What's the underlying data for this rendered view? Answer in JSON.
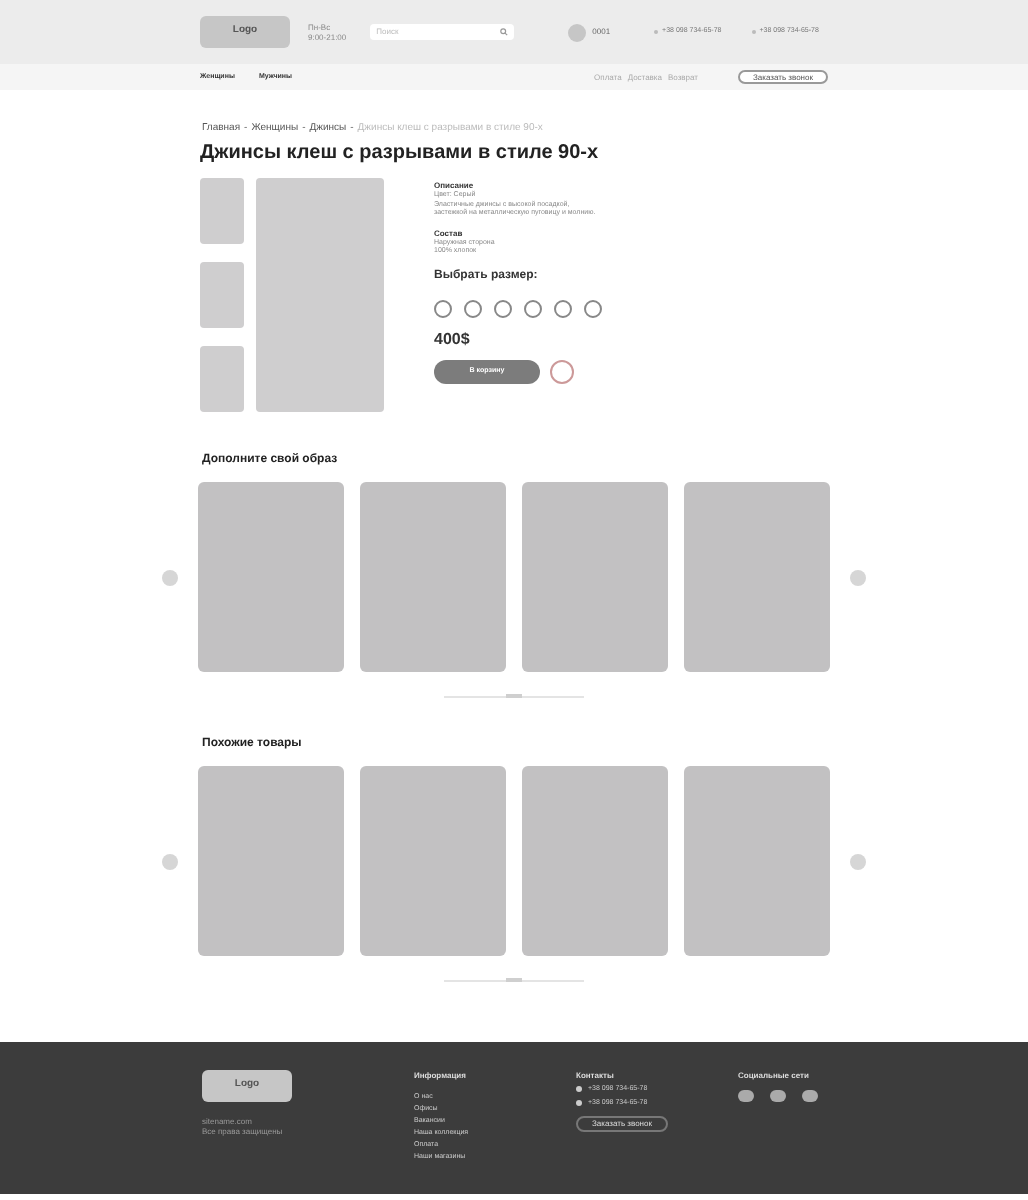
{
  "header": {
    "logo": "Logo",
    "hours": [
      "Пн-Вс",
      "9:00-21:00"
    ],
    "search_placeholder": "Поиск",
    "account": "0001",
    "phones": [
      "+38 098 734-65-78",
      "+38 098 734-65-78"
    ]
  },
  "nav": {
    "categories": [
      "Женщины",
      "Мужчины"
    ],
    "links": [
      "Оплата",
      "Доставка",
      "Возврат"
    ],
    "call_button": "Заказать звонок"
  },
  "breadcrumb_separator": "-",
  "breadcrumb": [
    {
      "label": "Главная",
      "current": false
    },
    {
      "label": "Женщины",
      "current": false
    },
    {
      "label": "Джинсы",
      "current": false
    },
    {
      "label": "Джинсы клеш с разрывами в стиле 90-х",
      "current": true
    }
  ],
  "title": "Джинсы клеш с разрывами в стиле 90-х",
  "description": {
    "heading": "Описание",
    "lines": [
      "Цвет: Серый",
      "Эластичные джинсы с высокой посадкой,",
      "застежкой на металлическую пуговицу и молнию."
    ]
  },
  "composition": {
    "heading": "Состав",
    "lines": [
      "Наружная сторона",
      "100% хлопок"
    ]
  },
  "size_heading": "Выбрать размер:",
  "sizes": [
    {
      "selected": false
    },
    {
      "selected": false
    },
    {
      "selected": false
    },
    {
      "selected": false
    },
    {
      "selected": false
    },
    {
      "selected": false
    }
  ],
  "price": "400$",
  "cart_button": "В корзину",
  "sections": [
    {
      "title": "Дополните свой образ"
    },
    {
      "title": "Похожие товары"
    }
  ],
  "footer": {
    "logo": "Logo",
    "site": "sitename.com",
    "rights": "Все права защищены",
    "info_heading": "Информация",
    "info_links": [
      "О нас",
      "Офисы",
      "Вакансии",
      "Наша коллекция",
      "Оплата",
      "Наши магазины"
    ],
    "contacts_heading": "Контакты",
    "phones": [
      "+38 098 734-65-78",
      "+38 098 734-65-78"
    ],
    "call_button": "Заказать звонок",
    "social_heading": "Социальные сети"
  }
}
